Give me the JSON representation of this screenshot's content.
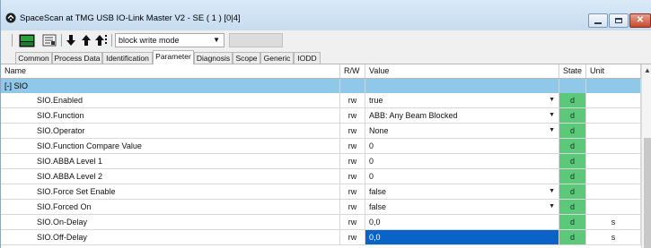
{
  "window": {
    "title": "SpaceScan at TMG USB IO-Link Master V2 - SE ( 1 ) [0|4]",
    "controls": {
      "minimize": "–",
      "maximize": "□",
      "close": "✕"
    }
  },
  "toolbar": {
    "icons": [
      "monitor-icon",
      "list-edit-icon",
      "download-arrow-icon",
      "upload-arrow-icon",
      "upload-all-icon"
    ],
    "mode_select": "block write mode",
    "dropdown_arrow": "▼"
  },
  "tabs": [
    "Common",
    "Process Data",
    "Identification",
    "Parameter",
    "Diagnosis",
    "Scope",
    "Generic",
    "IODD"
  ],
  "active_tab": "Parameter",
  "grid": {
    "columns": {
      "name": "Name",
      "rw": "R/W",
      "value": "Value",
      "state": "State",
      "unit": "Unit"
    },
    "group": "[-]  SIO",
    "rows": [
      {
        "name": "SIO.Enabled",
        "rw": "rw",
        "value": "true",
        "dropdown": true,
        "state": "d",
        "unit": ""
      },
      {
        "name": "SIO.Function",
        "rw": "rw",
        "value": "ABB: Any Beam Blocked",
        "dropdown": true,
        "state": "d",
        "unit": ""
      },
      {
        "name": "SIO.Operator",
        "rw": "rw",
        "value": "None",
        "dropdown": true,
        "state": "d",
        "unit": ""
      },
      {
        "name": "SIO.Function Compare Value",
        "rw": "rw",
        "value": "0",
        "dropdown": false,
        "state": "d",
        "unit": ""
      },
      {
        "name": "SIO.ABBA Level 1",
        "rw": "rw",
        "value": "0",
        "dropdown": false,
        "state": "d",
        "unit": ""
      },
      {
        "name": "SIO.ABBA Level 2",
        "rw": "rw",
        "value": "0",
        "dropdown": false,
        "state": "d",
        "unit": ""
      },
      {
        "name": "SIO.Force Set Enable",
        "rw": "rw",
        "value": "false",
        "dropdown": true,
        "state": "d",
        "unit": ""
      },
      {
        "name": "SIO.Forced On",
        "rw": "rw",
        "value": "false",
        "dropdown": true,
        "state": "d",
        "unit": ""
      },
      {
        "name": "SIO.On-Delay",
        "rw": "rw",
        "value": "0,0",
        "dropdown": false,
        "state": "d",
        "unit": "s"
      },
      {
        "name": "SIO.Off-Delay",
        "rw": "rw",
        "value": "0,0",
        "dropdown": false,
        "state": "d",
        "unit": "s",
        "selected": true
      }
    ],
    "scroll_up": "▲"
  },
  "colors": {
    "group_row": "#90c8ea",
    "state_cell": "#5cc87a",
    "selected_cell": "#0a64c8"
  }
}
